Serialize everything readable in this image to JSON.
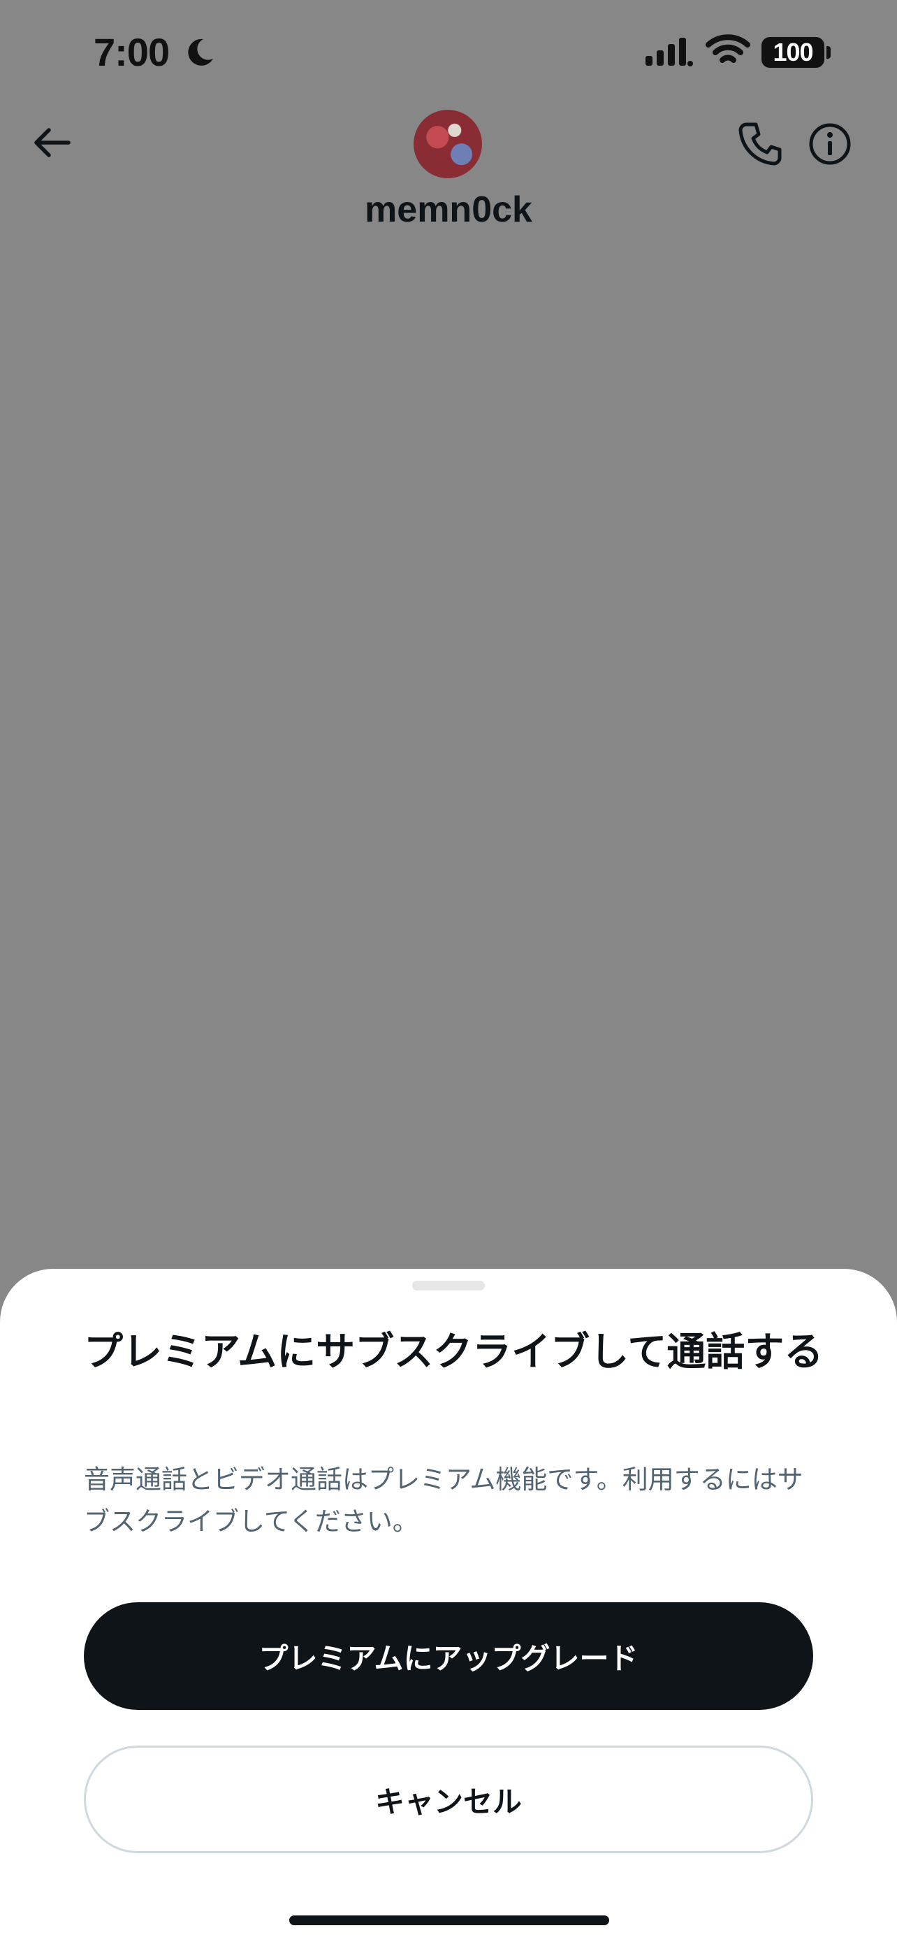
{
  "status_bar": {
    "time": "7:00",
    "battery": "100",
    "icons": [
      "moon-icon",
      "cellular-signal-icon",
      "wifi-icon",
      "battery-icon"
    ]
  },
  "header": {
    "username": "memn0ck",
    "icons": [
      "back-arrow-icon",
      "avatar",
      "phone-icon",
      "info-icon"
    ]
  },
  "sheet": {
    "title": "プレミアムにサブスクライブして通話する",
    "description": "音声通話とビデオ通話はプレミアム機能です。利用するにはサブスクライブしてください。",
    "primary_button": "プレミアムにアップグレード",
    "cancel_button": "キャンセル"
  },
  "colors": {
    "backdrop": "#878787",
    "sheet_background": "#ffffff",
    "primary_button": "#0f1419",
    "secondary_text": "#536471",
    "outline": "#cfd9de"
  }
}
